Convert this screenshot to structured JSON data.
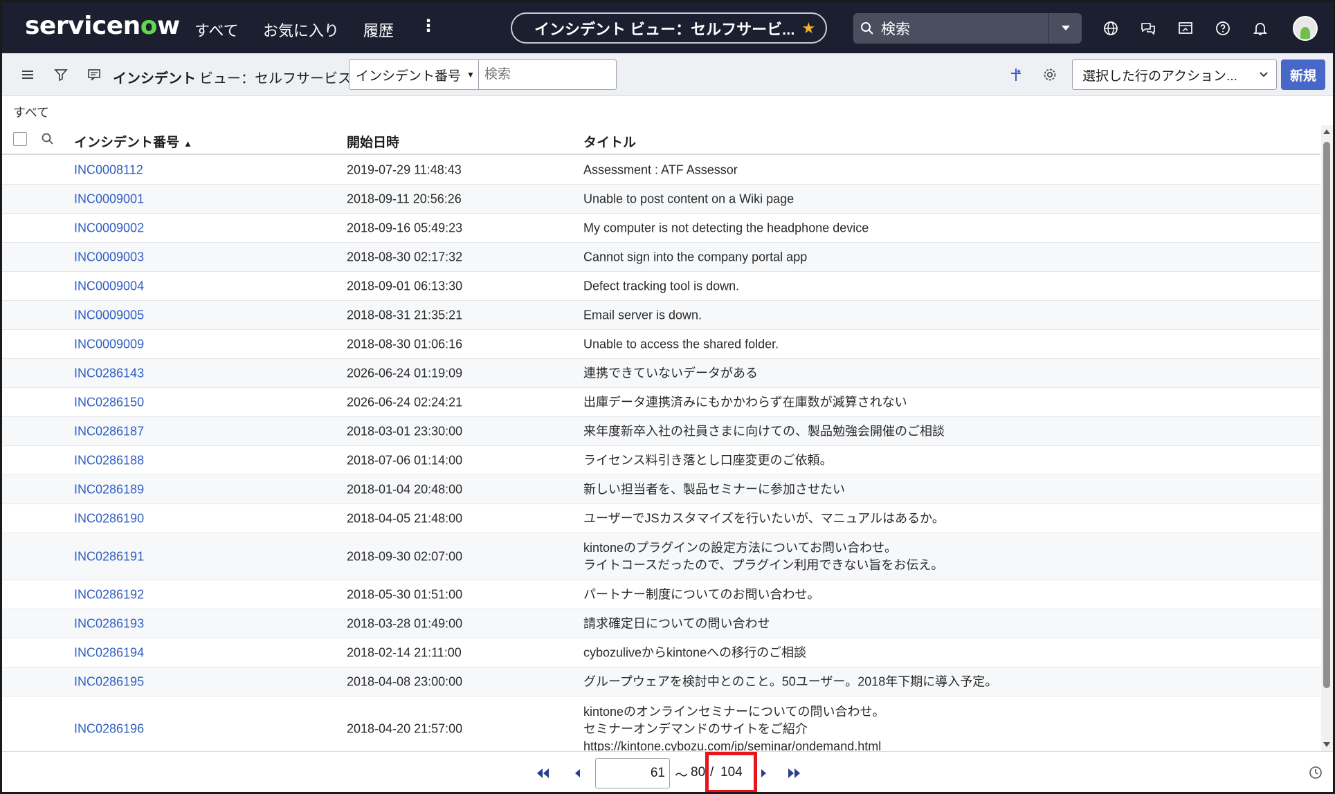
{
  "topnav": {
    "logo_pre": "servicen",
    "logo_o": "o",
    "logo_post": "w",
    "links": [
      "すべて",
      "お気に入り",
      "履歴"
    ],
    "more": "⋮",
    "context_title": "インシデント ビュー：セルフサービ...",
    "search_placeholder": "検索"
  },
  "listbar": {
    "title": "インシデント",
    "view": "ビュー：セルフサービス",
    "field_select": "インシデント番号",
    "search_placeholder": "検索",
    "action_select": "選択した行のアクション...",
    "new_button": "新規"
  },
  "breadcrumb": "すべて",
  "columns": [
    "インシデント番号",
    "開始日時",
    "タイトル"
  ],
  "rows": [
    {
      "number": "INC0008112",
      "date": "2019-07-29 11:48:43",
      "title": [
        "Assessment : ATF Assessor"
      ]
    },
    {
      "number": "INC0009001",
      "date": "2018-09-11 20:56:26",
      "title": [
        "Unable to post content on a Wiki page"
      ]
    },
    {
      "number": "INC0009002",
      "date": "2018-09-16 05:49:23",
      "title": [
        "My computer is not detecting the headphone device"
      ]
    },
    {
      "number": "INC0009003",
      "date": "2018-08-30 02:17:32",
      "title": [
        "Cannot sign into the company portal app"
      ]
    },
    {
      "number": "INC0009004",
      "date": "2018-09-01 06:13:30",
      "title": [
        "Defect tracking tool is down."
      ]
    },
    {
      "number": "INC0009005",
      "date": "2018-08-31 21:35:21",
      "title": [
        "Email server is down."
      ]
    },
    {
      "number": "INC0009009",
      "date": "2018-08-30 01:06:16",
      "title": [
        "Unable to access the shared folder."
      ]
    },
    {
      "number": "INC0286143",
      "date": "2026-06-24 01:19:09",
      "title": [
        "連携できていないデータがある"
      ]
    },
    {
      "number": "INC0286150",
      "date": "2026-06-24 02:24:21",
      "title": [
        "出庫データ連携済みにもかかわらず在庫数が減算されない"
      ]
    },
    {
      "number": "INC0286187",
      "date": "2018-03-01 23:30:00",
      "title": [
        "来年度新卒入社の社員さまに向けての、製品勉強会開催のご相談"
      ]
    },
    {
      "number": "INC0286188",
      "date": "2018-07-06 01:14:00",
      "title": [
        "ライセンス料引き落とし口座変更のご依頼。"
      ]
    },
    {
      "number": "INC0286189",
      "date": "2018-01-04 20:48:00",
      "title": [
        "新しい担当者を、製品セミナーに参加させたい"
      ]
    },
    {
      "number": "INC0286190",
      "date": "2018-04-05 21:48:00",
      "title": [
        "ユーザーでJSカスタマイズを行いたいが、マニュアルはあるか。"
      ]
    },
    {
      "number": "INC0286191",
      "date": "2018-09-30 02:07:00",
      "title": [
        "kintoneのプラグインの設定方法についてお問い合わせ。",
        "ライトコースだったので、プラグイン利用できない旨をお伝え。"
      ]
    },
    {
      "number": "INC0286192",
      "date": "2018-05-30 01:51:00",
      "title": [
        "パートナー制度についてのお問い合わせ。"
      ]
    },
    {
      "number": "INC0286193",
      "date": "2018-03-28 01:49:00",
      "title": [
        "請求確定日についての問い合わせ"
      ]
    },
    {
      "number": "INC0286194",
      "date": "2018-02-14 21:11:00",
      "title": [
        "cybozuliveからkintoneへの移行のご相談"
      ]
    },
    {
      "number": "INC0286195",
      "date": "2018-04-08 23:00:00",
      "title": [
        "グループウェアを検討中とのこと。50ユーザー。2018年下期に導入予定。"
      ]
    },
    {
      "number": "INC0286196",
      "date": "2018-04-20 21:57:00",
      "title": [
        "kintoneのオンラインセミナーについての問い合わせ。",
        "セミナーオンデマンドのサイトをご紹介",
        "https://kintone.cybozu.com/jp/seminar/ondemand.html"
      ]
    }
  ],
  "pager": {
    "from": "61",
    "tilde": "～",
    "to": "80",
    "slash": "/",
    "total": "104"
  },
  "colors": {
    "nav_bg": "#1b1f2f",
    "link": "#2f5fc4",
    "accent_button": "#4767c9",
    "highlight": "#e8141b",
    "logo_green": "#62d84e"
  }
}
